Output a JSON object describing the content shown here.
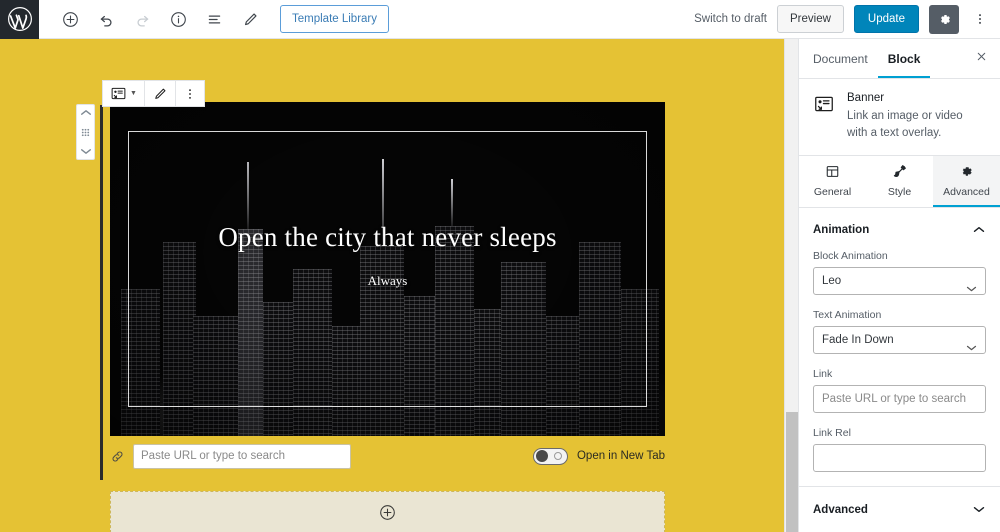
{
  "header": {
    "logo_icon": "wordpress-logo-icon",
    "tools": [
      {
        "name": "add-block-button",
        "icon": "plus-circle-icon",
        "disabled": false
      },
      {
        "name": "undo-button",
        "icon": "undo-arrow-icon",
        "disabled": false
      },
      {
        "name": "redo-button",
        "icon": "redo-arrow-icon",
        "disabled": true
      },
      {
        "name": "content-info-button",
        "icon": "info-circle-icon",
        "disabled": false
      },
      {
        "name": "block-navigation-button",
        "icon": "list-view-icon",
        "disabled": false
      },
      {
        "name": "edit-mode-button",
        "icon": "pencil-icon",
        "disabled": false
      }
    ],
    "template_library_label": "Template Library",
    "switch_to_draft_label": "Switch to draft",
    "preview_label": "Preview",
    "update_label": "Update",
    "settings_icon": "gear-icon",
    "more_icon": "kebab-menu-icon",
    "accent_blue": "#0085ba",
    "link_blue": "#3a7cb5"
  },
  "canvas": {
    "background_color": "#e5c234",
    "block_toolbar": {
      "block_type_icon": "banner-block-icon",
      "edit_icon": "pencil-icon",
      "more_options_icon": "kebab-menu-icon"
    },
    "mover": {
      "up_icon": "chevron-up-icon",
      "drag_icon": "drag-handle-icon",
      "down_icon": "chevron-down-icon"
    },
    "banner": {
      "title": "Open the city that never sleeps",
      "subtitle": "Always",
      "image_alt": "night city skyline"
    },
    "link_row": {
      "link_icon": "link-chain-icon",
      "url_placeholder": "Paste URL or type to search",
      "url_value": "",
      "new_tab_label": "Open in New Tab",
      "new_tab_enabled": false
    },
    "appender": {
      "icon": "plus-circle-icon",
      "label": ""
    }
  },
  "sidebar": {
    "tabs": [
      {
        "label": "Document",
        "active": false
      },
      {
        "label": "Block",
        "active": true
      }
    ],
    "close_icon": "close-x-icon",
    "block_card": {
      "icon": "banner-block-icon",
      "title": "Banner",
      "description": "Link an image or video with a text overlay."
    },
    "sub_tabs": [
      {
        "label": "General",
        "icon": "layout-grid-icon",
        "active": false
      },
      {
        "label": "Style",
        "icon": "paintbrush-icon",
        "active": false
      },
      {
        "label": "Advanced",
        "icon": "gear-icon",
        "active": true
      }
    ],
    "panels": [
      {
        "title": "Animation",
        "expanded": true,
        "chevron_icon": "chevron-up-icon",
        "fields": [
          {
            "label": "Block Animation",
            "type": "select",
            "value": "Leo",
            "chevron_icon": "chevron-down-icon"
          },
          {
            "label": "Text Animation",
            "type": "select",
            "value": "Fade In Down",
            "chevron_icon": "chevron-down-icon"
          },
          {
            "label": "Link",
            "type": "text",
            "value": "",
            "placeholder": "Paste URL or type to search"
          },
          {
            "label": "Link Rel",
            "type": "text",
            "value": "",
            "placeholder": ""
          }
        ]
      },
      {
        "title": "Advanced",
        "expanded": false,
        "chevron_icon": "chevron-down-icon",
        "fields": []
      }
    ]
  },
  "scrollbar": {
    "name": "editor-vertical-scrollbar",
    "thumb_position_pct": 76
  }
}
